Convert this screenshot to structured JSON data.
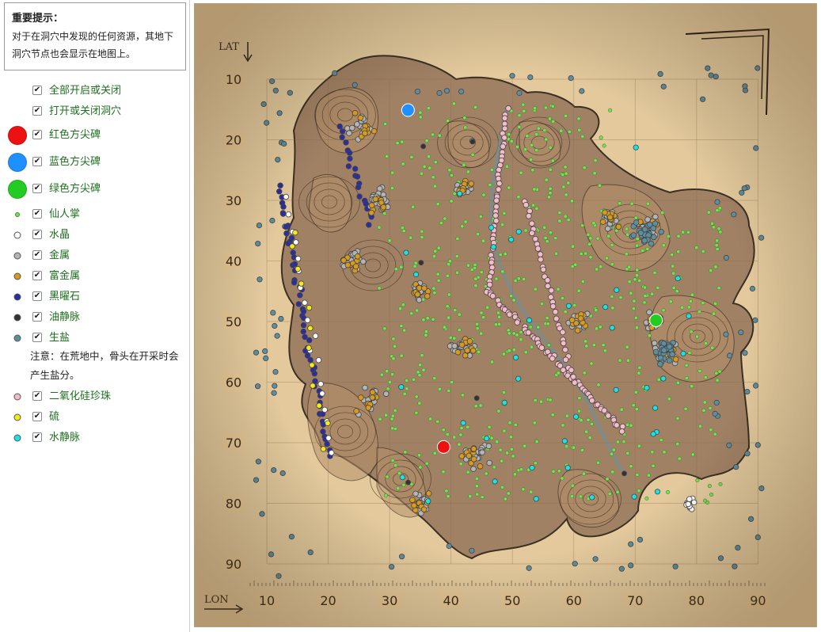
{
  "notice": {
    "title": "重要提示：",
    "body": "对于在洞穴中发现的任何资源，其地下洞穴节点也会显示在地图上。"
  },
  "legend": [
    {
      "label": "全部开启或关闭",
      "checked": true,
      "marker": null
    },
    {
      "label": "打开或关闭洞穴",
      "checked": true,
      "marker": null
    },
    {
      "label": "红色方尖碑",
      "checked": true,
      "marker": {
        "color": "#ee1111",
        "size": "large"
      }
    },
    {
      "label": "蓝色方尖碑",
      "checked": true,
      "marker": {
        "color": "#1e90ff",
        "size": "large"
      }
    },
    {
      "label": "绿色方尖碑",
      "checked": true,
      "marker": {
        "color": "#22cc22",
        "size": "large"
      }
    },
    {
      "label": "仙人掌",
      "checked": true,
      "marker": {
        "color": "#7ddc5a",
        "size": "tiny"
      }
    },
    {
      "label": "水晶",
      "checked": true,
      "marker": {
        "color": "#ffffff",
        "size": "small"
      }
    },
    {
      "label": "金属",
      "checked": true,
      "marker": {
        "color": "#b4b4b4",
        "size": "small"
      }
    },
    {
      "label": "富金属",
      "checked": true,
      "marker": {
        "color": "#d79a1c",
        "size": "small"
      }
    },
    {
      "label": "黑曜石",
      "checked": true,
      "marker": {
        "color": "#2b2e9e",
        "size": "small"
      }
    },
    {
      "label": "油静脉",
      "checked": true,
      "marker": {
        "color": "#333333",
        "size": "small"
      }
    },
    {
      "label": "生盐",
      "checked": true,
      "marker": {
        "color": "#5d8fa0",
        "size": "small"
      }
    },
    {
      "label": "二氧化硅珍珠",
      "checked": true,
      "marker": {
        "color": "#f3bcc8",
        "size": "small"
      }
    },
    {
      "label": "硫",
      "checked": true,
      "marker": {
        "color": "#f4ea1a",
        "size": "small"
      }
    },
    {
      "label": "水静脉",
      "checked": true,
      "marker": {
        "color": "#18e4e4",
        "size": "small"
      }
    }
  ],
  "note": "注意：在荒地中，骨头在开采时会产生盐分。",
  "map": {
    "lat_label": "LAT",
    "lon_label": "LON",
    "lat_ticks": [
      "10",
      "20",
      "30",
      "40",
      "50",
      "60",
      "70",
      "80",
      "90"
    ],
    "lon_ticks": [
      "10",
      "20",
      "30",
      "40",
      "50",
      "60",
      "70",
      "80",
      "90"
    ],
    "colors": {
      "parchment": "#e3c99c",
      "parchment_dark": "#b7926a",
      "land": "#9a7a5e",
      "land_outline": "#2a1f17",
      "grid": "#8a6a4a"
    },
    "obelisks": [
      {
        "name": "red",
        "color": "#ee1111",
        "lat": 70.7,
        "lon": 38.8
      },
      {
        "name": "blue",
        "color": "#1e90ff",
        "lat": 15.1,
        "lon": 33.0
      },
      {
        "name": "green",
        "color": "#22cc22",
        "lat": 49.8,
        "lon": 73.4
      }
    ],
    "resources": {
      "cactus": {
        "color": "#7ddc5a"
      },
      "crystal": {
        "color": "#ffffff"
      },
      "metal": {
        "color": "#b4b4b4"
      },
      "rich_metal": {
        "color": "#d79a1c"
      },
      "obsidian": {
        "color": "#2b2e9e"
      },
      "oil": {
        "color": "#333333"
      },
      "salt": {
        "color": "#5d8fa0"
      },
      "pearl": {
        "color": "#f3bcc8"
      },
      "sulfur": {
        "color": "#f4ea1a"
      },
      "water": {
        "color": "#18e4e4"
      }
    }
  }
}
